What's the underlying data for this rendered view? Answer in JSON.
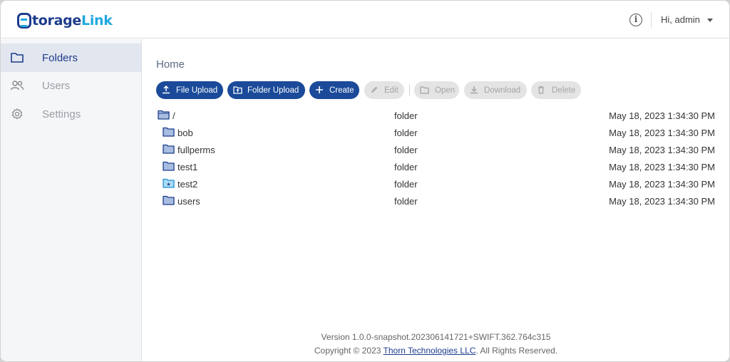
{
  "app": {
    "logo_part1": "torage",
    "logo_part2": "Link"
  },
  "header": {
    "user_label": "Hi, admin",
    "info_glyph": "i"
  },
  "sidebar": {
    "items": [
      {
        "label": "Folders",
        "icon": "folder-icon",
        "active": true
      },
      {
        "label": "Users",
        "icon": "users-icon",
        "active": false
      },
      {
        "label": "Settings",
        "icon": "gear-icon",
        "active": false
      }
    ]
  },
  "breadcrumb": "Home",
  "toolbar": {
    "file_upload": "File Upload",
    "folder_upload": "Folder Upload",
    "create": "Create",
    "edit": "Edit",
    "open": "Open",
    "download": "Download",
    "delete": "Delete"
  },
  "files": [
    {
      "name": "/",
      "type": "folder",
      "date": "May 18, 2023 1:34:30 PM",
      "icon": "folder-open-icon"
    },
    {
      "name": "bob",
      "type": "folder",
      "date": "May 18, 2023 1:34:30 PM",
      "icon": "folder-icon"
    },
    {
      "name": "fullperms",
      "type": "folder",
      "date": "May 18, 2023 1:34:30 PM",
      "icon": "folder-icon"
    },
    {
      "name": "test1",
      "type": "folder",
      "date": "May 18, 2023 1:34:30 PM",
      "icon": "folder-icon"
    },
    {
      "name": "test2",
      "type": "folder",
      "date": "May 18, 2023 1:34:30 PM",
      "icon": "shared-folder-icon"
    },
    {
      "name": "users",
      "type": "folder",
      "date": "May 18, 2023 1:34:30 PM",
      "icon": "folder-icon"
    }
  ],
  "footer": {
    "version": "Version 1.0.0-snapshot.202306141721+SWIFT.362.764c315",
    "copyright_prefix": "Copyright © 2023",
    "company": "Thorn Technologies LLC",
    "copyright_suffix": ". All Rights Reserved."
  },
  "colors": {
    "primary": "#1a4a99",
    "brand_dark": "#1d3c8c",
    "brand_light": "#1fa8e0",
    "folder_fill": "#a8bde0",
    "folder_stroke": "#1d3c8c",
    "shared_folder_fill": "#a9dcf5"
  }
}
